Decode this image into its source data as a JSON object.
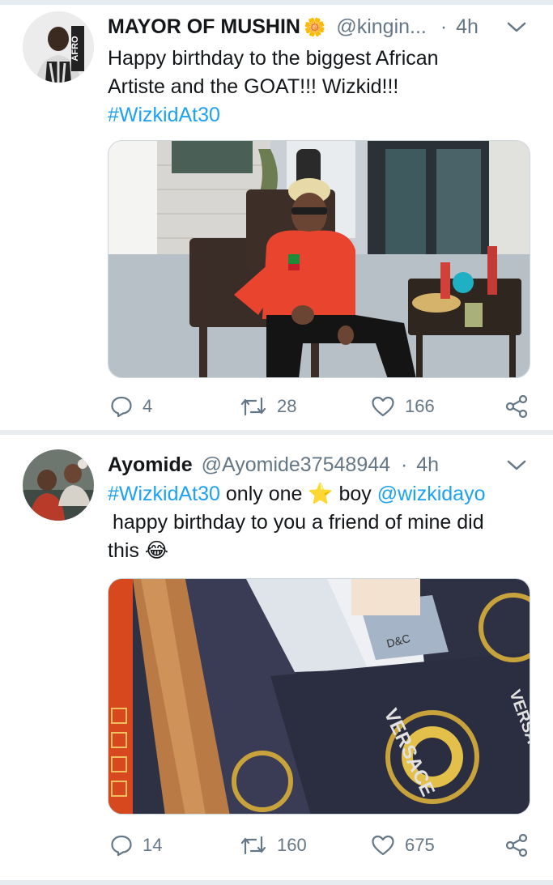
{
  "tweets": [
    {
      "name": "MAYOR OF MUSHIN",
      "name_emoji": "🌼",
      "handle": "@kingin...",
      "separator": "·",
      "time": "4h",
      "avatar_label": "AFRO",
      "text_line1": "Happy birthday to the biggest African",
      "text_line2": "Artiste and the GOAT!!! Wizkid!!!",
      "hashtag": "#WizkidAt30",
      "counts": {
        "replies": "4",
        "retweets": "28",
        "likes": "166"
      }
    },
    {
      "name": "Ayomide",
      "handle": "@Ayomide37548944",
      "separator": "·",
      "time": "4h",
      "hashtag": "#WizkidAt30",
      "text_a": " only one ",
      "star": "⭐",
      "text_b": " boy ",
      "mention": "@wizkidayo",
      "text_line2": "happy birthday to you a friend of mine did",
      "text_line3": "this",
      "emoji": "😂",
      "media_text": [
        "VERSACE",
        "VERSACE",
        "D&C"
      ],
      "counts": {
        "replies": "14",
        "retweets": "160",
        "likes": "675"
      }
    }
  ],
  "colors": {
    "accent": "#1da1f2",
    "text": "#14171a",
    "muted": "#657786",
    "divider": "#e6ecf0"
  },
  "icons": [
    "chevron-down-icon",
    "reply-icon",
    "retweet-icon",
    "like-icon",
    "share-icon"
  ]
}
